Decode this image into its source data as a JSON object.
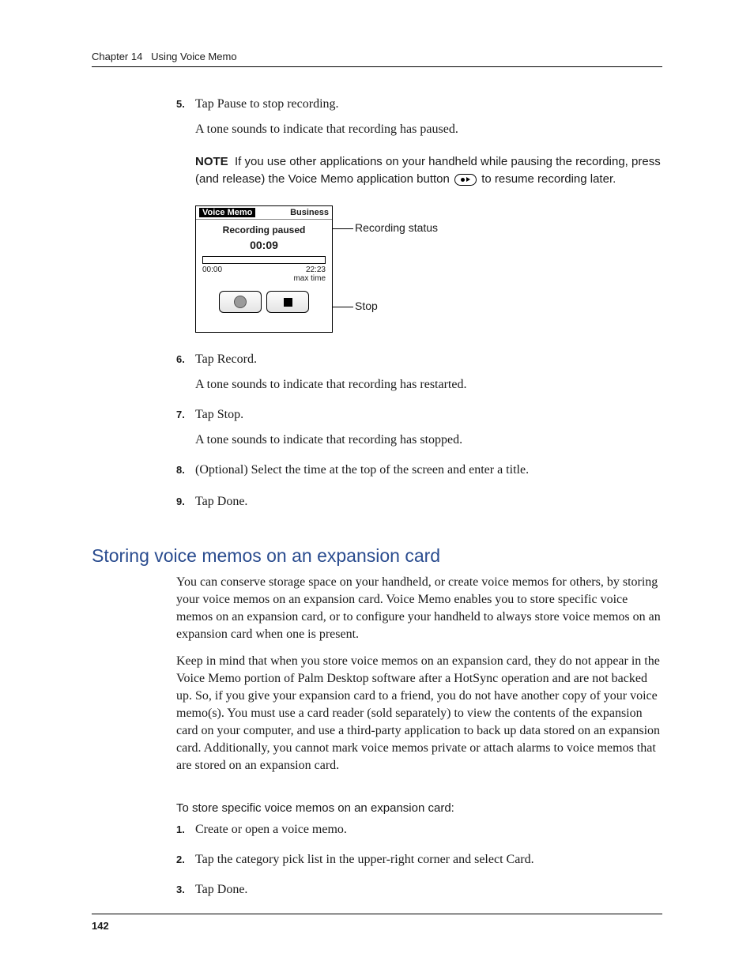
{
  "header": {
    "chapter": "Chapter 14",
    "title": "Using Voice Memo"
  },
  "steps_a": {
    "s5": {
      "num": "5.",
      "text": "Tap Pause to stop recording.",
      "sub": "A tone sounds to indicate that recording has paused."
    },
    "note": {
      "label": "NOTE",
      "text_before": "If you use other applications on your handheld while pausing the recording, press (and release) the Voice Memo application button ",
      "text_after": " to resume recording later."
    },
    "s6": {
      "num": "6.",
      "text": "Tap Record.",
      "sub": "A tone sounds to indicate that recording has restarted."
    },
    "s7": {
      "num": "7.",
      "text": "Tap Stop.",
      "sub": "A tone sounds to indicate that recording has stopped."
    },
    "s8": {
      "num": "8.",
      "text": "(Optional) Select the time at the top of the screen and enter a title."
    },
    "s9": {
      "num": "9.",
      "text": "Tap Done."
    }
  },
  "device": {
    "title": "Voice Memo",
    "category": "Business",
    "status": "Recording paused",
    "elapsed": "00:09",
    "start": "00:00",
    "max": "22:23",
    "max_label": "max time"
  },
  "annotations": {
    "status": "Recording status",
    "stop": "Stop"
  },
  "section": {
    "title": "Storing voice memos on an expansion card",
    "p1": "You can conserve storage space on your handheld, or create voice memos for others, by storing your voice memos on an expansion card. Voice Memo enables you to store specific voice memos on an expansion card, or to configure your handheld to always store voice memos on an expansion card when one is present.",
    "p2": "Keep in mind that when you store voice memos on an expansion card, they do not appear in the Voice Memo portion of Palm Desktop software after a HotSync operation and are not backed up. So, if you give your expansion card to a friend, you do not have another copy of your voice memo(s). You must use a card reader (sold separately) to view the contents of the expansion card on your computer, and use a third-party application to back up data stored on an expansion card. Additionally, you cannot mark voice memos private or attach alarms to voice memos that are stored on an expansion card.",
    "subhead": "To store specific voice memos on an expansion card:",
    "steps": {
      "s1": {
        "num": "1.",
        "text": "Create or open a voice memo."
      },
      "s2": {
        "num": "2.",
        "text": "Tap the category pick list in the upper-right corner and select Card."
      },
      "s3": {
        "num": "3.",
        "text": "Tap Done."
      }
    }
  },
  "page_number": "142"
}
